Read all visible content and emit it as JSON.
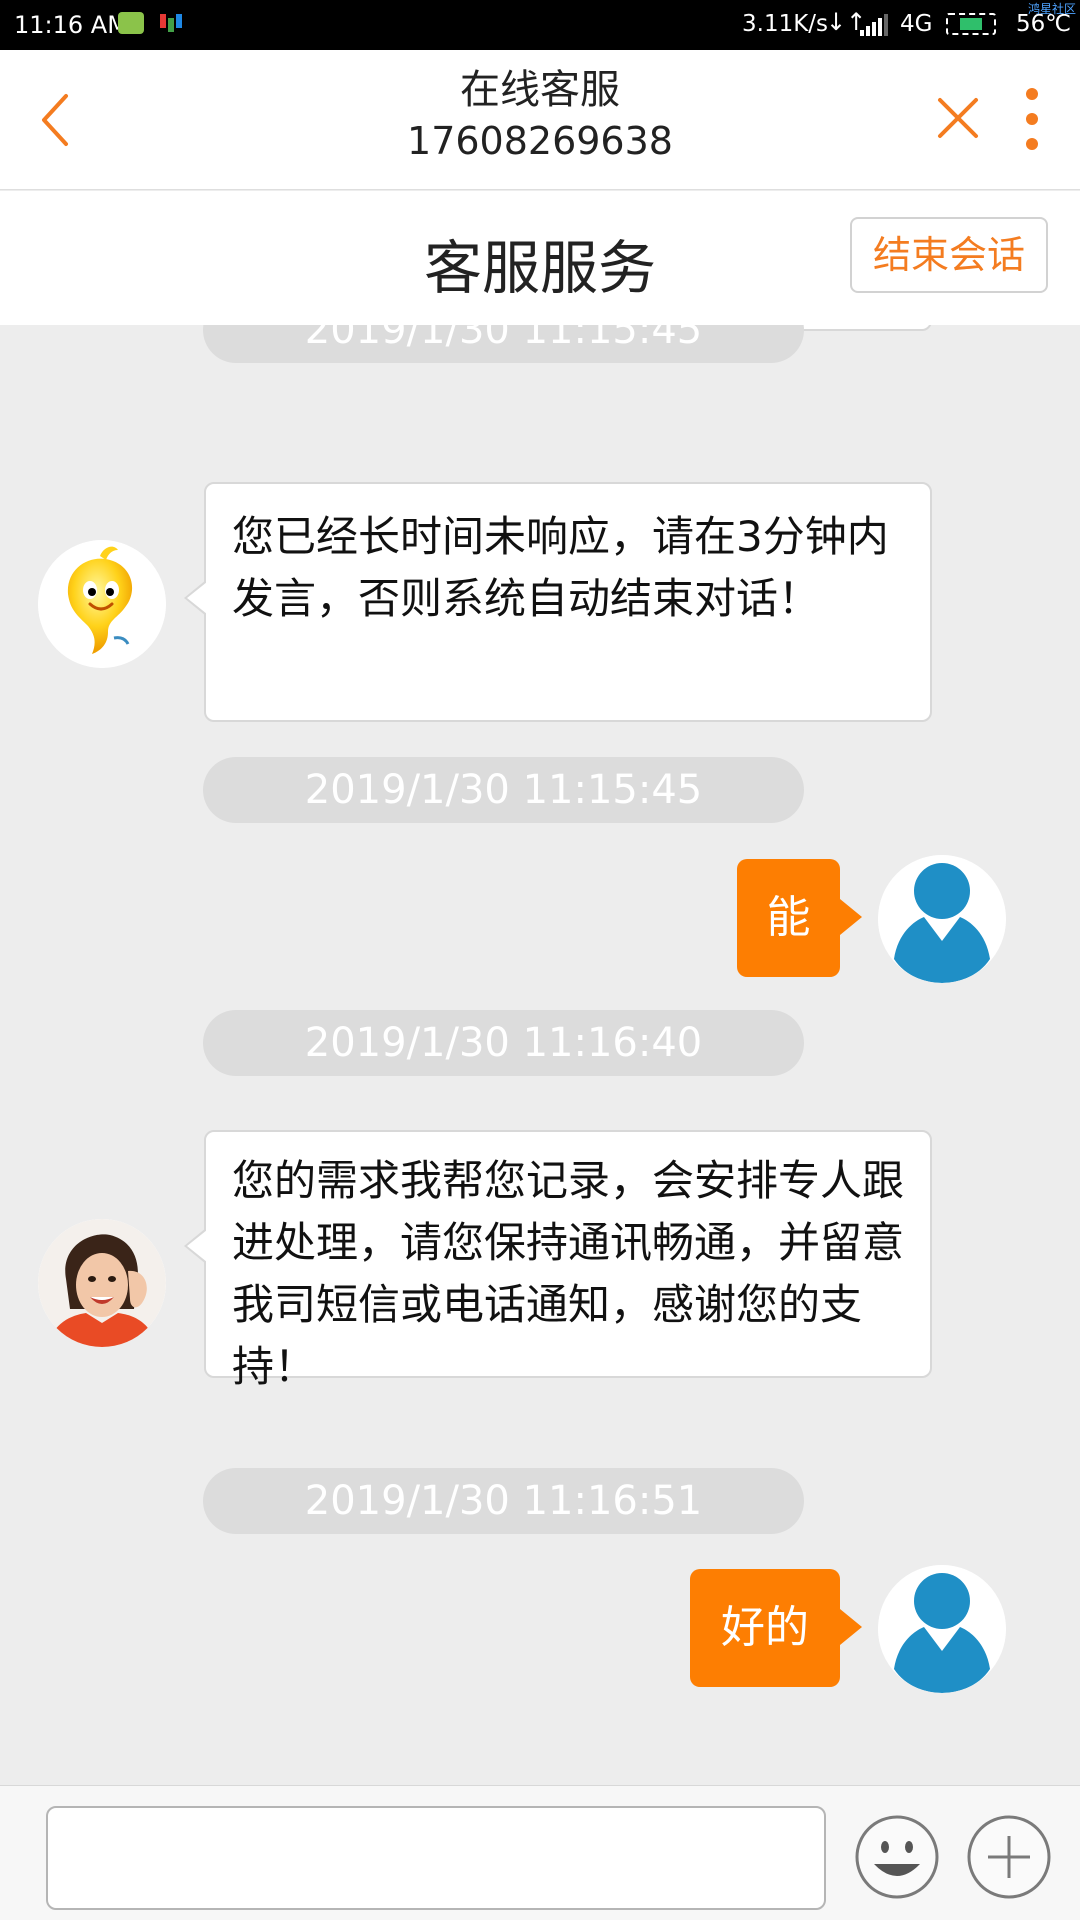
{
  "status_bar": {
    "time": "11:16 AM",
    "speed": "3.11K/s",
    "arrows": "↓↑",
    "network": "4G",
    "temperature": "56℃",
    "corner_tag": "鸿星社区"
  },
  "header": {
    "title": "在线客服",
    "subtitle": "17608269638",
    "accent_color": "#f47c20"
  },
  "service": {
    "title": "客服服务",
    "end_button": "结束会话"
  },
  "messages": {
    "t1": "2019/1/30 11:15:45",
    "m1": "您已经长时间未响应，请在3分钟内发言，否则系统自动结束对话！",
    "t2": "2019/1/30 11:15:45",
    "m2": "能",
    "t3": "2019/1/30 11:16:40",
    "m3": " 您的需求我帮您记录，会安排专人跟进处理，请您保持通讯畅通，并留意我司短信或电话通知，感谢您的支持！",
    "t4": "2019/1/30 11:16:51",
    "m4": "好的"
  },
  "input": {
    "value": "",
    "placeholder": ""
  },
  "icons": [
    "back-icon",
    "close-icon",
    "more-icon",
    "robot-avatar",
    "agent-avatar",
    "user-avatar",
    "emoji-icon",
    "plus-icon"
  ],
  "colors": {
    "outgoing_bubble": "#fd7e02",
    "background": "#ededed",
    "time_pill": "#dcdcdc"
  }
}
